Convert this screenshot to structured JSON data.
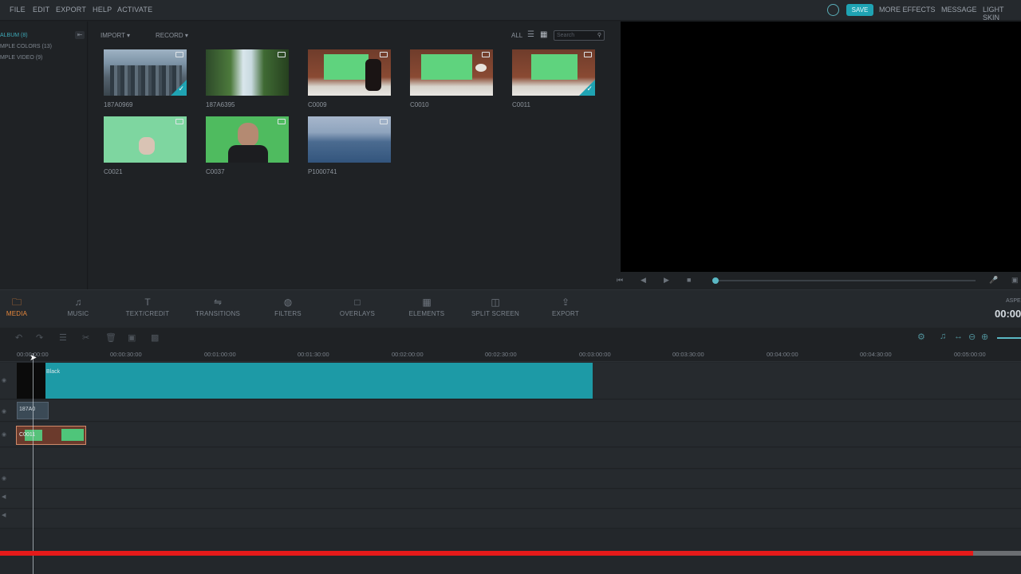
{
  "menu": [
    "FILE",
    "EDIT",
    "EXPORT",
    "HELP",
    "ACTIVATE"
  ],
  "topright": {
    "save": "SAVE",
    "more_effects": "MORE EFFECTS",
    "message": "MESSAGE",
    "light_skin": "LIGHT SKIN"
  },
  "album": {
    "items": [
      "ALBUM (8)",
      "MPLE COLORS (13)",
      "MPLE VIDEO (9)"
    ]
  },
  "library": {
    "import": "IMPORT",
    "record": "RECORD",
    "all": "ALL",
    "search_placeholder": "Search"
  },
  "thumbs": [
    {
      "label": "187A0969",
      "checked": true,
      "kind": "city"
    },
    {
      "label": "187A6395",
      "checked": false,
      "kind": "waterfall"
    },
    {
      "label": "C0009",
      "checked": false,
      "kind": "green"
    },
    {
      "label": "C0010",
      "checked": false,
      "kind": "green"
    },
    {
      "label": "C0011",
      "checked": true,
      "kind": "green"
    },
    {
      "label": "C0021",
      "checked": false,
      "kind": "greenhand"
    },
    {
      "label": "C0037",
      "checked": false,
      "kind": "person"
    },
    {
      "label": "P1000741",
      "checked": false,
      "kind": "sea"
    }
  ],
  "tabs": [
    {
      "label": "MEDIA",
      "icon": "folder-icon",
      "active": true
    },
    {
      "label": "MUSIC",
      "icon": "music-icon",
      "active": false
    },
    {
      "label": "TEXT/CREDIT",
      "icon": "text-icon",
      "active": false
    },
    {
      "label": "TRANSITIONS",
      "icon": "transitions-icon",
      "active": false
    },
    {
      "label": "FILTERS",
      "icon": "filters-icon",
      "active": false
    },
    {
      "label": "OVERLAYS",
      "icon": "overlays-icon",
      "active": false
    },
    {
      "label": "ELEMENTS",
      "icon": "elements-icon",
      "active": false
    },
    {
      "label": "SPLIT SCREEN",
      "icon": "split-screen-icon",
      "active": false
    },
    {
      "label": "EXPORT",
      "icon": "export-icon",
      "active": false
    }
  ],
  "aspect_label": "ASPE",
  "time_display": "00:00",
  "ruler": [
    "00:00:00:00",
    "00:00:30:00",
    "00:01:00:00",
    "00:01:30:00",
    "00:02:00:00",
    "00:02:30:00",
    "00:03:00:00",
    "00:03:30:00",
    "00:04:00:00",
    "00:04:30:00",
    "00:05:00:00"
  ],
  "clips": {
    "black": "Black",
    "clip2": "187A0",
    "clip3": "C0011"
  },
  "progress": {
    "fraction": 0.953
  },
  "colors": {
    "accent": "#1fa3b3",
    "active_tab": "#e7873b",
    "teal_clip": "#1d9aa6",
    "progress_red": "#e51a1a"
  }
}
